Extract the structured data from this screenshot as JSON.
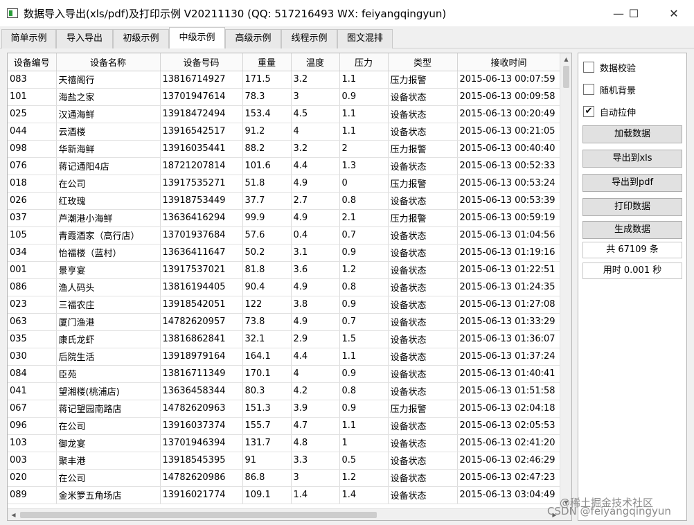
{
  "window": {
    "title": "数据导入导出(xls/pdf)及打印示例 V20211130 (QQ: 517216493 WX: feiyangqingyun)",
    "minimize": "—",
    "maximize": "☐",
    "close": "✕"
  },
  "tabs": [
    {
      "label": "简单示例"
    },
    {
      "label": "导入导出"
    },
    {
      "label": "初级示例"
    },
    {
      "label": "中级示例",
      "active": true
    },
    {
      "label": "高级示例"
    },
    {
      "label": "线程示例"
    },
    {
      "label": "图文混排"
    }
  ],
  "table": {
    "columns": [
      "设备编号",
      "设备名称",
      "设备号码",
      "重量",
      "温度",
      "压力",
      "类型",
      "接收时间"
    ],
    "rows": [
      [
        "083",
        "天禧阁行",
        "13816714927",
        "171.5",
        "3.2",
        "1.1",
        "压力报警",
        "2015-06-13 00:07:59"
      ],
      [
        "101",
        "海盐之家",
        "13701947614",
        "78.3",
        "3",
        "0.9",
        "设备状态",
        "2015-06-13 00:09:58"
      ],
      [
        "025",
        "汉通海鲜",
        "13918472494",
        "153.4",
        "4.5",
        "1.1",
        "设备状态",
        "2015-06-13 00:20:49"
      ],
      [
        "044",
        "云酒楼",
        "13916542517",
        "91.2",
        "4",
        "1.1",
        "设备状态",
        "2015-06-13 00:21:05"
      ],
      [
        "098",
        "华新海鲜",
        "13916035441",
        "88.2",
        "3.2",
        "2",
        "压力报警",
        "2015-06-13 00:40:40"
      ],
      [
        "076",
        "蒋记通阳4店",
        "18721207814",
        "101.6",
        "4.4",
        "1.3",
        "设备状态",
        "2015-06-13 00:52:33"
      ],
      [
        "018",
        "在公司",
        "13917535271",
        "51.8",
        "4.9",
        "0",
        "压力报警",
        "2015-06-13 00:53:24"
      ],
      [
        "026",
        "红玫瑰",
        "13918753449",
        "37.7",
        "2.7",
        "0.8",
        "设备状态",
        "2015-06-13 00:53:39"
      ],
      [
        "037",
        "芦潮港小海鲜",
        "13636416294",
        "99.9",
        "4.9",
        "2.1",
        "压力报警",
        "2015-06-13 00:59:19"
      ],
      [
        "105",
        "青霞酒家（高行店）",
        "13701937684",
        "57.6",
        "0.4",
        "0.7",
        "设备状态",
        "2015-06-13 01:04:56"
      ],
      [
        "034",
        "怡福楼（蓝村）",
        "13636411647",
        "50.2",
        "3.1",
        "0.9",
        "设备状态",
        "2015-06-13 01:19:16"
      ],
      [
        "001",
        "景亨宴",
        "13917537021",
        "81.8",
        "3.6",
        "1.2",
        "设备状态",
        "2015-06-13 01:22:51"
      ],
      [
        "086",
        "渔人码头",
        "13816194405",
        "90.4",
        "4.9",
        "0.8",
        "设备状态",
        "2015-06-13 01:24:35"
      ],
      [
        "023",
        "三福农庄",
        "13918542051",
        "122",
        "3.8",
        "0.9",
        "设备状态",
        "2015-06-13 01:27:08"
      ],
      [
        "063",
        "厦门渔港",
        "14782620957",
        "73.8",
        "4.9",
        "0.7",
        "设备状态",
        "2015-06-13 01:33:29"
      ],
      [
        "035",
        "康氏龙虾",
        "13816862841",
        "32.1",
        "2.9",
        "1.5",
        "设备状态",
        "2015-06-13 01:36:07"
      ],
      [
        "030",
        "后院生活",
        "13918979164",
        "164.1",
        "4.4",
        "1.1",
        "设备状态",
        "2015-06-13 01:37:24"
      ],
      [
        "084",
        "臣苑",
        "13816711349",
        "170.1",
        "4",
        "0.9",
        "设备状态",
        "2015-06-13 01:40:41"
      ],
      [
        "041",
        "望湘楼(桃浦店)",
        "13636458344",
        "80.3",
        "4.2",
        "0.8",
        "设备状态",
        "2015-06-13 01:51:58"
      ],
      [
        "067",
        "蒋记望园南路店",
        "14782620963",
        "151.3",
        "3.9",
        "0.9",
        "压力报警",
        "2015-06-13 02:04:18"
      ],
      [
        "096",
        "在公司",
        "13916037374",
        "155.7",
        "4.7",
        "1.1",
        "设备状态",
        "2015-06-13 02:05:53"
      ],
      [
        "103",
        "御龙宴",
        "13701946394",
        "131.7",
        "4.8",
        "1",
        "设备状态",
        "2015-06-13 02:41:20"
      ],
      [
        "003",
        "聚丰港",
        "13918545395",
        "91",
        "3.3",
        "0.5",
        "设备状态",
        "2015-06-13 02:46:29"
      ],
      [
        "020",
        "在公司",
        "14782620986",
        "86.8",
        "3",
        "1.2",
        "设备状态",
        "2015-06-13 02:47:23"
      ],
      [
        "089",
        "金米箩五角场店",
        "13916021774",
        "109.1",
        "1.4",
        "1.4",
        "设备状态",
        "2015-06-13 03:04:49"
      ]
    ]
  },
  "scroll": {
    "up": "▲",
    "down": "▼",
    "left": "◀",
    "right": "▶"
  },
  "panel": {
    "check_validate": {
      "label": "数据校验",
      "checked": false
    },
    "check_random_bg": {
      "label": "随机背景",
      "checked": false
    },
    "check_auto_stretch": {
      "label": "自动拉伸",
      "checked": true
    },
    "checkmark": "✔",
    "btn_load": "加载数据",
    "btn_export_xls": "导出到xls",
    "btn_export_pdf": "导出到pdf",
    "btn_print": "打印数据",
    "btn_generate": "生成数据",
    "count_label": "共 67109 条",
    "time_label": "用时 0.001 秒"
  },
  "watermark": {
    "line1": "@稀土掘金技术社区",
    "line2": "CSDN @feiyangqingyun"
  }
}
